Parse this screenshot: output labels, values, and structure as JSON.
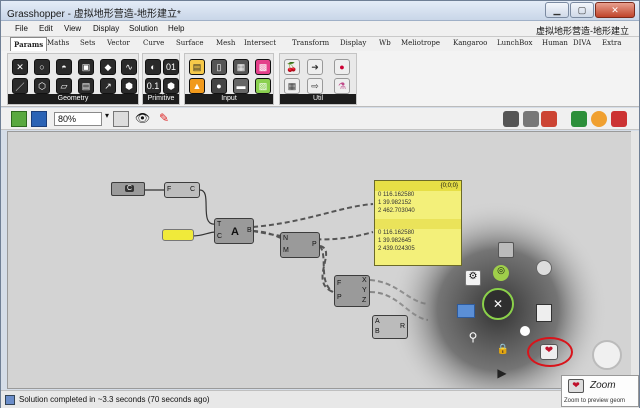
{
  "window": {
    "title": "Grasshopper - 虚拟地形营造-地形建立*"
  },
  "menubar": {
    "items": [
      "File",
      "Edit",
      "View",
      "Display",
      "Solution",
      "Help"
    ],
    "right_title": "虚拟地形营造-地形建立"
  },
  "tabs": [
    "Params",
    "Maths",
    "Sets",
    "Vector",
    "Curve",
    "Surface",
    "Mesh",
    "Intersect",
    "Transform",
    "Display",
    "Wb",
    "Meliotrope",
    "Kangaroo",
    "LunchBox",
    "Human",
    "DIVA",
    "Extra"
  ],
  "ribbon": {
    "panels": [
      "Geometry",
      "Primitive",
      "Input",
      "Util"
    ]
  },
  "toolbar": {
    "zoom": "80%"
  },
  "canvas": {
    "nodes": {
      "curve_param": "C",
      "f_c": {
        "left": "F",
        "right": "C"
      },
      "a_block": {
        "inputs": [
          "T",
          "C"
        ],
        "body": "A",
        "out": "B"
      },
      "n_m_p": {
        "inputs": [
          "N",
          "M"
        ],
        "out": "P"
      },
      "f_p_xyz": {
        "left": [
          "F",
          "P"
        ],
        "right": [
          "X",
          "Y",
          "Z"
        ]
      },
      "a_b_r": {
        "left": [
          "A",
          "B"
        ],
        "right": "R"
      }
    },
    "panel": {
      "header": "{0;0;0}",
      "rows": [
        "0 116.162580",
        "1 39.982152",
        "2 462.703040",
        "0 116.162580",
        "1 39.982645",
        "2 439.024305"
      ]
    }
  },
  "status": {
    "text": "Solution completed in ~3.3 seconds (70 seconds ago)"
  },
  "tooltip": {
    "title": "Zoom",
    "subtitle": "Zoom to preview geom"
  },
  "colors": {
    "highlight_circle": "#d9141b",
    "panel_yellow": "#f3f07a",
    "canvas_bg": "#d3d3d3"
  }
}
